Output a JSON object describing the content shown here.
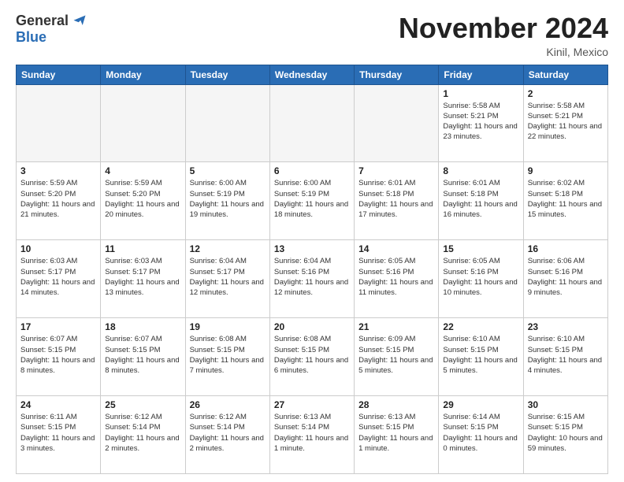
{
  "logo": {
    "general": "General",
    "blue": "Blue"
  },
  "header": {
    "month": "November 2024",
    "location": "Kinil, Mexico"
  },
  "weekdays": [
    "Sunday",
    "Monday",
    "Tuesday",
    "Wednesday",
    "Thursday",
    "Friday",
    "Saturday"
  ],
  "weeks": [
    [
      {
        "day": "",
        "empty": true
      },
      {
        "day": "",
        "empty": true
      },
      {
        "day": "",
        "empty": true
      },
      {
        "day": "",
        "empty": true
      },
      {
        "day": "",
        "empty": true
      },
      {
        "day": "1",
        "sunrise": "5:58 AM",
        "sunset": "5:21 PM",
        "daylight": "11 hours and 23 minutes."
      },
      {
        "day": "2",
        "sunrise": "5:58 AM",
        "sunset": "5:21 PM",
        "daylight": "11 hours and 22 minutes."
      }
    ],
    [
      {
        "day": "3",
        "sunrise": "5:59 AM",
        "sunset": "5:20 PM",
        "daylight": "11 hours and 21 minutes."
      },
      {
        "day": "4",
        "sunrise": "5:59 AM",
        "sunset": "5:20 PM",
        "daylight": "11 hours and 20 minutes."
      },
      {
        "day": "5",
        "sunrise": "6:00 AM",
        "sunset": "5:19 PM",
        "daylight": "11 hours and 19 minutes."
      },
      {
        "day": "6",
        "sunrise": "6:00 AM",
        "sunset": "5:19 PM",
        "daylight": "11 hours and 18 minutes."
      },
      {
        "day": "7",
        "sunrise": "6:01 AM",
        "sunset": "5:18 PM",
        "daylight": "11 hours and 17 minutes."
      },
      {
        "day": "8",
        "sunrise": "6:01 AM",
        "sunset": "5:18 PM",
        "daylight": "11 hours and 16 minutes."
      },
      {
        "day": "9",
        "sunrise": "6:02 AM",
        "sunset": "5:18 PM",
        "daylight": "11 hours and 15 minutes."
      }
    ],
    [
      {
        "day": "10",
        "sunrise": "6:03 AM",
        "sunset": "5:17 PM",
        "daylight": "11 hours and 14 minutes."
      },
      {
        "day": "11",
        "sunrise": "6:03 AM",
        "sunset": "5:17 PM",
        "daylight": "11 hours and 13 minutes."
      },
      {
        "day": "12",
        "sunrise": "6:04 AM",
        "sunset": "5:17 PM",
        "daylight": "11 hours and 12 minutes."
      },
      {
        "day": "13",
        "sunrise": "6:04 AM",
        "sunset": "5:16 PM",
        "daylight": "11 hours and 12 minutes."
      },
      {
        "day": "14",
        "sunrise": "6:05 AM",
        "sunset": "5:16 PM",
        "daylight": "11 hours and 11 minutes."
      },
      {
        "day": "15",
        "sunrise": "6:05 AM",
        "sunset": "5:16 PM",
        "daylight": "11 hours and 10 minutes."
      },
      {
        "day": "16",
        "sunrise": "6:06 AM",
        "sunset": "5:16 PM",
        "daylight": "11 hours and 9 minutes."
      }
    ],
    [
      {
        "day": "17",
        "sunrise": "6:07 AM",
        "sunset": "5:15 PM",
        "daylight": "11 hours and 8 minutes."
      },
      {
        "day": "18",
        "sunrise": "6:07 AM",
        "sunset": "5:15 PM",
        "daylight": "11 hours and 8 minutes."
      },
      {
        "day": "19",
        "sunrise": "6:08 AM",
        "sunset": "5:15 PM",
        "daylight": "11 hours and 7 minutes."
      },
      {
        "day": "20",
        "sunrise": "6:08 AM",
        "sunset": "5:15 PM",
        "daylight": "11 hours and 6 minutes."
      },
      {
        "day": "21",
        "sunrise": "6:09 AM",
        "sunset": "5:15 PM",
        "daylight": "11 hours and 5 minutes."
      },
      {
        "day": "22",
        "sunrise": "6:10 AM",
        "sunset": "5:15 PM",
        "daylight": "11 hours and 5 minutes."
      },
      {
        "day": "23",
        "sunrise": "6:10 AM",
        "sunset": "5:15 PM",
        "daylight": "11 hours and 4 minutes."
      }
    ],
    [
      {
        "day": "24",
        "sunrise": "6:11 AM",
        "sunset": "5:15 PM",
        "daylight": "11 hours and 3 minutes."
      },
      {
        "day": "25",
        "sunrise": "6:12 AM",
        "sunset": "5:14 PM",
        "daylight": "11 hours and 2 minutes."
      },
      {
        "day": "26",
        "sunrise": "6:12 AM",
        "sunset": "5:14 PM",
        "daylight": "11 hours and 2 minutes."
      },
      {
        "day": "27",
        "sunrise": "6:13 AM",
        "sunset": "5:14 PM",
        "daylight": "11 hours and 1 minute."
      },
      {
        "day": "28",
        "sunrise": "6:13 AM",
        "sunset": "5:15 PM",
        "daylight": "11 hours and 1 minute."
      },
      {
        "day": "29",
        "sunrise": "6:14 AM",
        "sunset": "5:15 PM",
        "daylight": "11 hours and 0 minutes."
      },
      {
        "day": "30",
        "sunrise": "6:15 AM",
        "sunset": "5:15 PM",
        "daylight": "10 hours and 59 minutes."
      }
    ]
  ]
}
